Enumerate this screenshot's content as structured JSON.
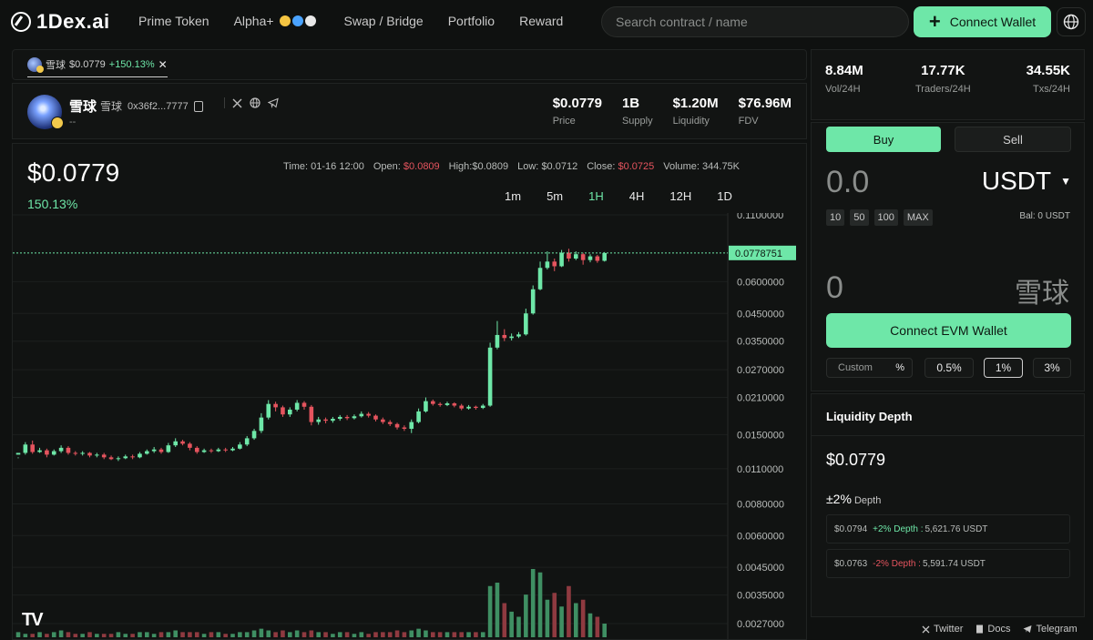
{
  "brand": {
    "logo_text": "1Dex.ai"
  },
  "nav": {
    "items": [
      "Prime Token",
      "Alpha+",
      "Swap / Bridge",
      "Portfolio",
      "Reward"
    ]
  },
  "search": {
    "placeholder": "Search contract / name"
  },
  "header_actions": {
    "connect_wallet": "Connect Wallet"
  },
  "token_tab": {
    "name": "雪球",
    "price": "$0.0779",
    "change": "+150.13%",
    "close": "✕"
  },
  "token": {
    "name": "雪球",
    "symbol": "雪球",
    "address": "0x36f2...7777",
    "description": "--",
    "stats": [
      {
        "value": "$0.0779",
        "label": "Price"
      },
      {
        "value": "1B",
        "label": "Supply"
      },
      {
        "value": "$1.20M",
        "label": "Liquidity"
      },
      {
        "value": "$76.96M",
        "label": "FDV"
      }
    ]
  },
  "chart_panel": {
    "price": "$0.0779",
    "change": "150.13%",
    "ohlc": {
      "time_label": "Time:",
      "time": "01-16 12:00",
      "open_label": "Open:",
      "open": "$0.0809",
      "high_label": "High:",
      "high": "$0.0809",
      "low_label": "Low:",
      "low": "$0.0712",
      "close_label": "Close:",
      "close": "$0.0725",
      "volume_label": "Volume:",
      "volume": "344.75K"
    },
    "intervals": [
      "1m",
      "5m",
      "1H",
      "4H",
      "12H",
      "1D"
    ],
    "active_interval": "1H",
    "tv_logo": "TV"
  },
  "chart_data": {
    "type": "candlestick",
    "y_scale": "log",
    "y_ticks": [
      "0.1100000",
      "0.0600000",
      "0.0450000",
      "0.0350000",
      "0.0270000",
      "0.0210000",
      "0.0150000",
      "0.0110000",
      "0.0080000",
      "0.0060000",
      "0.0045000",
      "0.0035000",
      "0.0027000"
    ],
    "current_price_label": "0.0778751",
    "current_price": 0.0778751,
    "colors": {
      "up": "#6ee7a8",
      "down": "#e5545e",
      "volume_up": "#3f8f63",
      "volume_down": "#8f3a40"
    },
    "candles": [
      [
        0.0125,
        0.0127,
        0.0122,
        0.0121
      ],
      [
        0.0127,
        0.0137,
        0.014,
        0.0125
      ],
      [
        0.0137,
        0.0128,
        0.0142,
        0.0126
      ],
      [
        0.0128,
        0.013,
        0.0133,
        0.0127
      ],
      [
        0.013,
        0.0125,
        0.0132,
        0.0122
      ],
      [
        0.0125,
        0.0129,
        0.0131,
        0.0124
      ],
      [
        0.0129,
        0.0133,
        0.0136,
        0.0127
      ],
      [
        0.0133,
        0.0127,
        0.0135,
        0.0125
      ],
      [
        0.0127,
        0.0126,
        0.0129,
        0.0124
      ],
      [
        0.0126,
        0.0127,
        0.0129,
        0.0124
      ],
      [
        0.0127,
        0.0124,
        0.0128,
        0.0122
      ],
      [
        0.0124,
        0.0125,
        0.0127,
        0.0122
      ],
      [
        0.0125,
        0.0122,
        0.0127,
        0.012
      ],
      [
        0.0122,
        0.012,
        0.0124,
        0.0119
      ],
      [
        0.012,
        0.0121,
        0.0123,
        0.0118
      ],
      [
        0.0121,
        0.0123,
        0.0125,
        0.012
      ],
      [
        0.0123,
        0.0122,
        0.0125,
        0.012
      ],
      [
        0.0122,
        0.0126,
        0.0128,
        0.0121
      ],
      [
        0.0126,
        0.0129,
        0.0131,
        0.0125
      ],
      [
        0.0129,
        0.0131,
        0.0134,
        0.0127
      ],
      [
        0.0131,
        0.0128,
        0.0133,
        0.0126
      ],
      [
        0.0128,
        0.0136,
        0.0139,
        0.0127
      ],
      [
        0.0136,
        0.0141,
        0.0145,
        0.0134
      ],
      [
        0.0141,
        0.0138,
        0.0143,
        0.0136
      ],
      [
        0.0138,
        0.0133,
        0.014,
        0.013
      ],
      [
        0.0133,
        0.0128,
        0.0135,
        0.0126
      ],
      [
        0.0128,
        0.013,
        0.0132,
        0.0127
      ],
      [
        0.013,
        0.0129,
        0.0132,
        0.0127
      ],
      [
        0.0129,
        0.0131,
        0.0133,
        0.0128
      ],
      [
        0.0131,
        0.013,
        0.0133,
        0.0128
      ],
      [
        0.013,
        0.0132,
        0.0134,
        0.0129
      ],
      [
        0.0132,
        0.0137,
        0.014,
        0.0131
      ],
      [
        0.0137,
        0.0145,
        0.0148,
        0.0135
      ],
      [
        0.0145,
        0.0155,
        0.0158,
        0.0143
      ],
      [
        0.0155,
        0.0175,
        0.0182,
        0.0152
      ],
      [
        0.0175,
        0.0198,
        0.0205,
        0.0172
      ],
      [
        0.0198,
        0.0192,
        0.0202,
        0.0185
      ],
      [
        0.0192,
        0.018,
        0.0195,
        0.0176
      ],
      [
        0.018,
        0.0188,
        0.0192,
        0.0176
      ],
      [
        0.0188,
        0.02,
        0.0205,
        0.0185
      ],
      [
        0.02,
        0.0193,
        0.0203,
        0.0188
      ],
      [
        0.0193,
        0.0168,
        0.0196,
        0.0163
      ],
      [
        0.0168,
        0.0172,
        0.0176,
        0.0164
      ],
      [
        0.0172,
        0.017,
        0.0175,
        0.0166
      ],
      [
        0.017,
        0.0173,
        0.0176,
        0.0167
      ],
      [
        0.0173,
        0.0176,
        0.0179,
        0.017
      ],
      [
        0.0176,
        0.0174,
        0.0179,
        0.0171
      ],
      [
        0.0174,
        0.0177,
        0.018,
        0.0172
      ],
      [
        0.0177,
        0.0181,
        0.0185,
        0.0175
      ],
      [
        0.0181,
        0.0178,
        0.0184,
        0.0175
      ],
      [
        0.0178,
        0.0172,
        0.018,
        0.0169
      ],
      [
        0.0172,
        0.0168,
        0.0175,
        0.0165
      ],
      [
        0.0168,
        0.0165,
        0.0171,
        0.0162
      ],
      [
        0.0165,
        0.016,
        0.0167,
        0.0157
      ],
      [
        0.016,
        0.0158,
        0.0163,
        0.0155
      ],
      [
        0.0158,
        0.0168,
        0.0172,
        0.0152
      ],
      [
        0.0168,
        0.0185,
        0.019,
        0.0166
      ],
      [
        0.0185,
        0.0203,
        0.021,
        0.0183
      ],
      [
        0.0203,
        0.0198,
        0.0206,
        0.0195
      ],
      [
        0.0198,
        0.0196,
        0.0201,
        0.0193
      ],
      [
        0.0196,
        0.0199,
        0.0202,
        0.0194
      ],
      [
        0.0199,
        0.0195,
        0.0201,
        0.0192
      ],
      [
        0.0195,
        0.019,
        0.0198,
        0.0187
      ],
      [
        0.019,
        0.0193,
        0.0196,
        0.0188
      ],
      [
        0.0193,
        0.0191,
        0.0195,
        0.0188
      ],
      [
        0.0191,
        0.0195,
        0.0198,
        0.0189
      ],
      [
        0.0195,
        0.033,
        0.0345,
        0.0193
      ],
      [
        0.033,
        0.037,
        0.042,
        0.0325
      ],
      [
        0.037,
        0.036,
        0.039,
        0.035
      ],
      [
        0.036,
        0.0365,
        0.0375,
        0.0352
      ],
      [
        0.0365,
        0.0372,
        0.038,
        0.036
      ],
      [
        0.0372,
        0.045,
        0.047,
        0.0368
      ],
      [
        0.045,
        0.056,
        0.058,
        0.0445
      ],
      [
        0.056,
        0.068,
        0.072,
        0.0555
      ],
      [
        0.068,
        0.072,
        0.079,
        0.067
      ],
      [
        0.072,
        0.069,
        0.074,
        0.066
      ],
      [
        0.069,
        0.078,
        0.08,
        0.0685
      ],
      [
        0.078,
        0.074,
        0.0809,
        0.072
      ],
      [
        0.074,
        0.077,
        0.079,
        0.073
      ],
      [
        0.077,
        0.073,
        0.078,
        0.07
      ],
      [
        0.073,
        0.0755,
        0.077,
        0.0715
      ],
      [
        0.0755,
        0.0725,
        0.0765,
        0.0712
      ],
      [
        0.0725,
        0.0778,
        0.0785,
        0.072
      ]
    ],
    "volumes": [
      3,
      2,
      2,
      3,
      2,
      3,
      4,
      3,
      2,
      2,
      3,
      2,
      2,
      2,
      3,
      2,
      2,
      3,
      3,
      2,
      3,
      3,
      4,
      3,
      3,
      3,
      2,
      3,
      3,
      2,
      2,
      3,
      3,
      4,
      5,
      4,
      3,
      4,
      3,
      4,
      3,
      4,
      3,
      3,
      2,
      3,
      3,
      2,
      3,
      2,
      3,
      3,
      3,
      4,
      3,
      4,
      5,
      4,
      3,
      3,
      3,
      3,
      3,
      3,
      3,
      3,
      30,
      32,
      20,
      15,
      12,
      25,
      40,
      38,
      22,
      26,
      18,
      30,
      20,
      22,
      14,
      12,
      8
    ]
  },
  "right_stats": [
    {
      "value": "8.84M",
      "label": "Vol/24H"
    },
    {
      "value": "17.77K",
      "label": "Traders/24H"
    },
    {
      "value": "34.55K",
      "label": "Txs/24H"
    }
  ],
  "trade": {
    "buy": "Buy",
    "sell": "Sell",
    "amount_in": "0.0",
    "currency": "USDT",
    "quick_amounts": [
      "10",
      "50",
      "100",
      "MAX"
    ],
    "balance": "Bal: 0 USDT",
    "amount_out": "0",
    "token_out": "雪球",
    "connect_evm": "Connect EVM Wallet",
    "slippage_custom": "Custom",
    "slippage_pct": "%",
    "slippages": [
      "0.5%",
      "1%",
      "3%"
    ],
    "active_slippage": "1%"
  },
  "depth": {
    "title": "Liquidity Depth",
    "price": "$0.0779",
    "label_pm": "±2%",
    "label_text": "Depth",
    "rows": [
      {
        "price": "$0.0794",
        "tag": "+2% Depth :",
        "value": "5,621.76 USDT",
        "side": "up"
      },
      {
        "price": "$0.0763",
        "tag": "-2% Depth :",
        "value": "5,591.74 USDT",
        "side": "down"
      }
    ]
  },
  "footer": {
    "twitter": "Twitter",
    "docs": "Docs",
    "telegram": "Telegram"
  }
}
